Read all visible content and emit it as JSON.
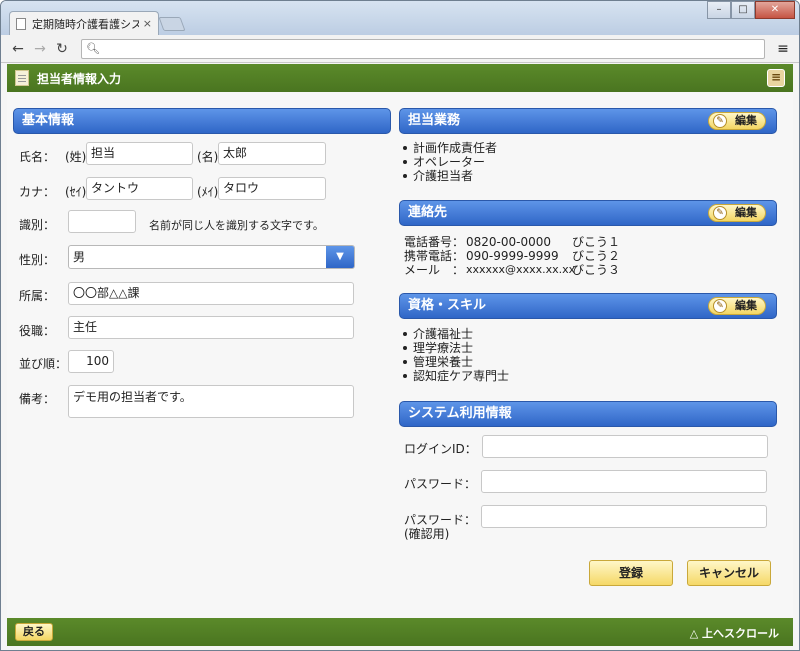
{
  "browser": {
    "tab_title": "定期随時介護看護システ",
    "tab_close": "×",
    "address": ""
  },
  "header": {
    "title": "担当者情報入力"
  },
  "basic": {
    "title": "基本情報",
    "name_label": "氏名：",
    "sei_label": "(姓)",
    "sei_value": "担当",
    "mei_label": "(名)",
    "mei_value": "太郎",
    "kana_label": "カナ：",
    "kana_sei_label": "(ｾｲ)",
    "kana_sei_value": "タントウ",
    "kana_mei_label": "(ﾒｲ)",
    "kana_mei_value": "タロウ",
    "id_label": "識別：",
    "id_value": "",
    "id_hint": "名前が同じ人を識別する文字です。",
    "gender_label": "性別：",
    "gender_value": "男",
    "dept_label": "所属：",
    "dept_value": "〇〇部△△課",
    "position_label": "役職：",
    "position_value": "主任",
    "order_label": "並び順：",
    "order_value": "100",
    "note_label": "備考：",
    "note_value": "デモ用の担当者です。"
  },
  "duties": {
    "title": "担当業務",
    "edit_label": "編集",
    "items": [
      "計画作成責任者",
      "オペレーター",
      "介護担当者"
    ]
  },
  "contact": {
    "title": "連絡先",
    "edit_label": "編集",
    "rows": [
      {
        "label": "電話番号：",
        "value": "0820-00-0000",
        "note": "びこう１"
      },
      {
        "label": "携帯電話：",
        "value": "090-9999-9999",
        "note": "びこう２"
      },
      {
        "label": "メール　：",
        "value": "xxxxxx@xxxx.xx.xx",
        "note": "びこう３"
      }
    ]
  },
  "skills": {
    "title": "資格・スキル",
    "edit_label": "編集",
    "items": [
      "介護福祉士",
      "理学療法士",
      "管理栄養士",
      "認知症ケア専門士"
    ]
  },
  "system": {
    "title": "システム利用情報",
    "login_label": "ログインID：",
    "password_label": "パスワード：",
    "confirm_label": "パスワード：",
    "confirm_sub": "(確認用)"
  },
  "actions": {
    "register": "登録",
    "cancel": "キャンセル"
  },
  "footer": {
    "back": "戻る",
    "scroll_top": "△ 上へスクロール"
  }
}
